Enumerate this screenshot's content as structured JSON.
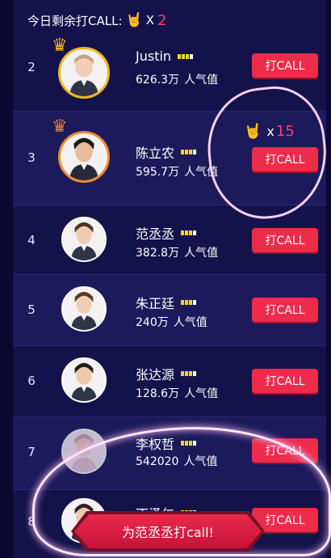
{
  "header": {
    "remaining_label": "今日剩余打CALL:",
    "hand_icon": "rock-hand-icon",
    "multiplier": "X",
    "remaining_count": "2"
  },
  "rows": [
    {
      "rank": "2",
      "name": "Justin",
      "popularity": "626.3万",
      "pop_label": "人气值",
      "button": "打CALL",
      "crown": "gold"
    },
    {
      "rank": "3",
      "name": "陈立农",
      "popularity": "595.7万",
      "pop_label": "人气值",
      "button": "打CALL",
      "crown": "orange"
    },
    {
      "rank": "4",
      "name": "范丞丞",
      "popularity": "382.8万",
      "pop_label": "人气值",
      "button": "打CALL"
    },
    {
      "rank": "5",
      "name": "朱正廷",
      "popularity": "240万",
      "pop_label": "人气值",
      "button": "打CALL"
    },
    {
      "rank": "6",
      "name": "张达源",
      "popularity": "128.6万",
      "pop_label": "人气值",
      "button": "打CALL"
    },
    {
      "rank": "7",
      "name": "李权哲",
      "popularity": "542020",
      "pop_label": "人气值",
      "button": "打CALL"
    },
    {
      "rank": "8",
      "name": "丁泽仁",
      "popularity": "",
      "pop_label": "",
      "button": "打CALL"
    }
  ],
  "bonus": {
    "multiplier": "x",
    "count": "15"
  },
  "cheer_button": "为范丞丞打call!",
  "colors": {
    "accent": "#ee2b4b",
    "background": "#14124a",
    "gold": "#f2b51e",
    "orange": "#f18a2e"
  }
}
